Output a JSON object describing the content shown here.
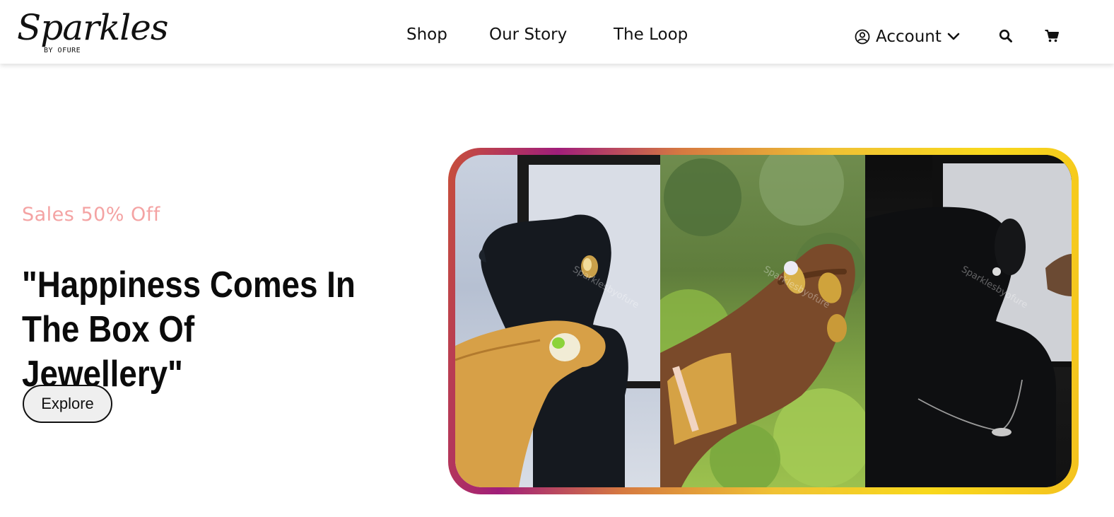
{
  "brand": {
    "name": "Sparkles",
    "tagline": "BY OFURE"
  },
  "nav": {
    "items": [
      "Shop",
      "Our Story",
      "The Loop"
    ],
    "account_label": "Account"
  },
  "icons": {
    "account": "user-circle-icon",
    "dropdown": "chevron-down-icon",
    "search": "search-icon",
    "cart": "cart-icon"
  },
  "hero": {
    "promo": "Sales 50% Off",
    "headline_line1": "\"Happiness Comes In",
    "headline_line2": "The Box Of Jewellery\"",
    "cta_label": "Explore"
  },
  "gallery": {
    "watermark": "Sparklesbyofure",
    "panels": [
      "earring-on-bust-photo",
      "rings-and-bracelets-photo",
      "stud-and-necklace-on-bust-photo"
    ]
  },
  "colors": {
    "promo": "#f4a3a3",
    "frame_gradient": [
      "#c8503a",
      "#a01e7a",
      "#d67a40",
      "#f0c234",
      "#f8d81c"
    ]
  }
}
